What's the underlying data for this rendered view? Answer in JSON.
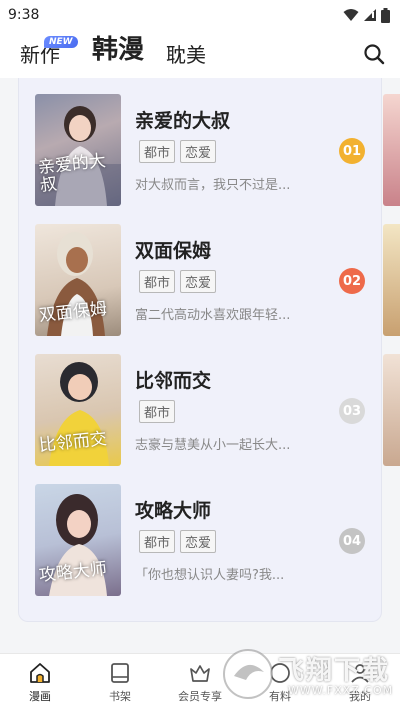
{
  "status": {
    "time": "9:38"
  },
  "header": {
    "tabs": [
      {
        "label": "新作",
        "badge": "NEW"
      },
      {
        "label": "韩漫"
      },
      {
        "label": "耽美"
      }
    ]
  },
  "items": [
    {
      "title": "亲爱的大叔",
      "cover_text": "亲爱的大叔",
      "tags": [
        "都市",
        "恋爱"
      ],
      "desc": "对大叔而言，我只不过是...",
      "rank": "01",
      "rank_color": "#f2b130"
    },
    {
      "title": "双面保姆",
      "cover_text": "双面保姆",
      "tags": [
        "都市",
        "恋爱"
      ],
      "desc": "富二代高动水喜欢跟年轻...",
      "rank": "02",
      "rank_color": "#ee6a4a"
    },
    {
      "title": "比邻而交",
      "cover_text": "比邻而交",
      "tags": [
        "都市"
      ],
      "desc": "志豪与慧美从小一起长大...",
      "rank": "03",
      "rank_color": "#d9d9d9"
    },
    {
      "title": "攻略大师",
      "cover_text": "攻略大师",
      "tags": [
        "都市",
        "恋爱"
      ],
      "desc": "「你也想认识人妻吗?我...",
      "rank": "04",
      "rank_color": "#c4c4c4"
    }
  ],
  "nav": [
    {
      "label": "漫画",
      "icon": "home-icon"
    },
    {
      "label": "书架",
      "icon": "bookshelf-icon"
    },
    {
      "label": "会员专享",
      "icon": "crown-icon"
    },
    {
      "label": "有料",
      "icon": "discover-icon"
    },
    {
      "label": "我的",
      "icon": "profile-icon"
    }
  ],
  "watermark": {
    "text": "飞翔下载",
    "url": "WWW.FXXZ.COM"
  }
}
